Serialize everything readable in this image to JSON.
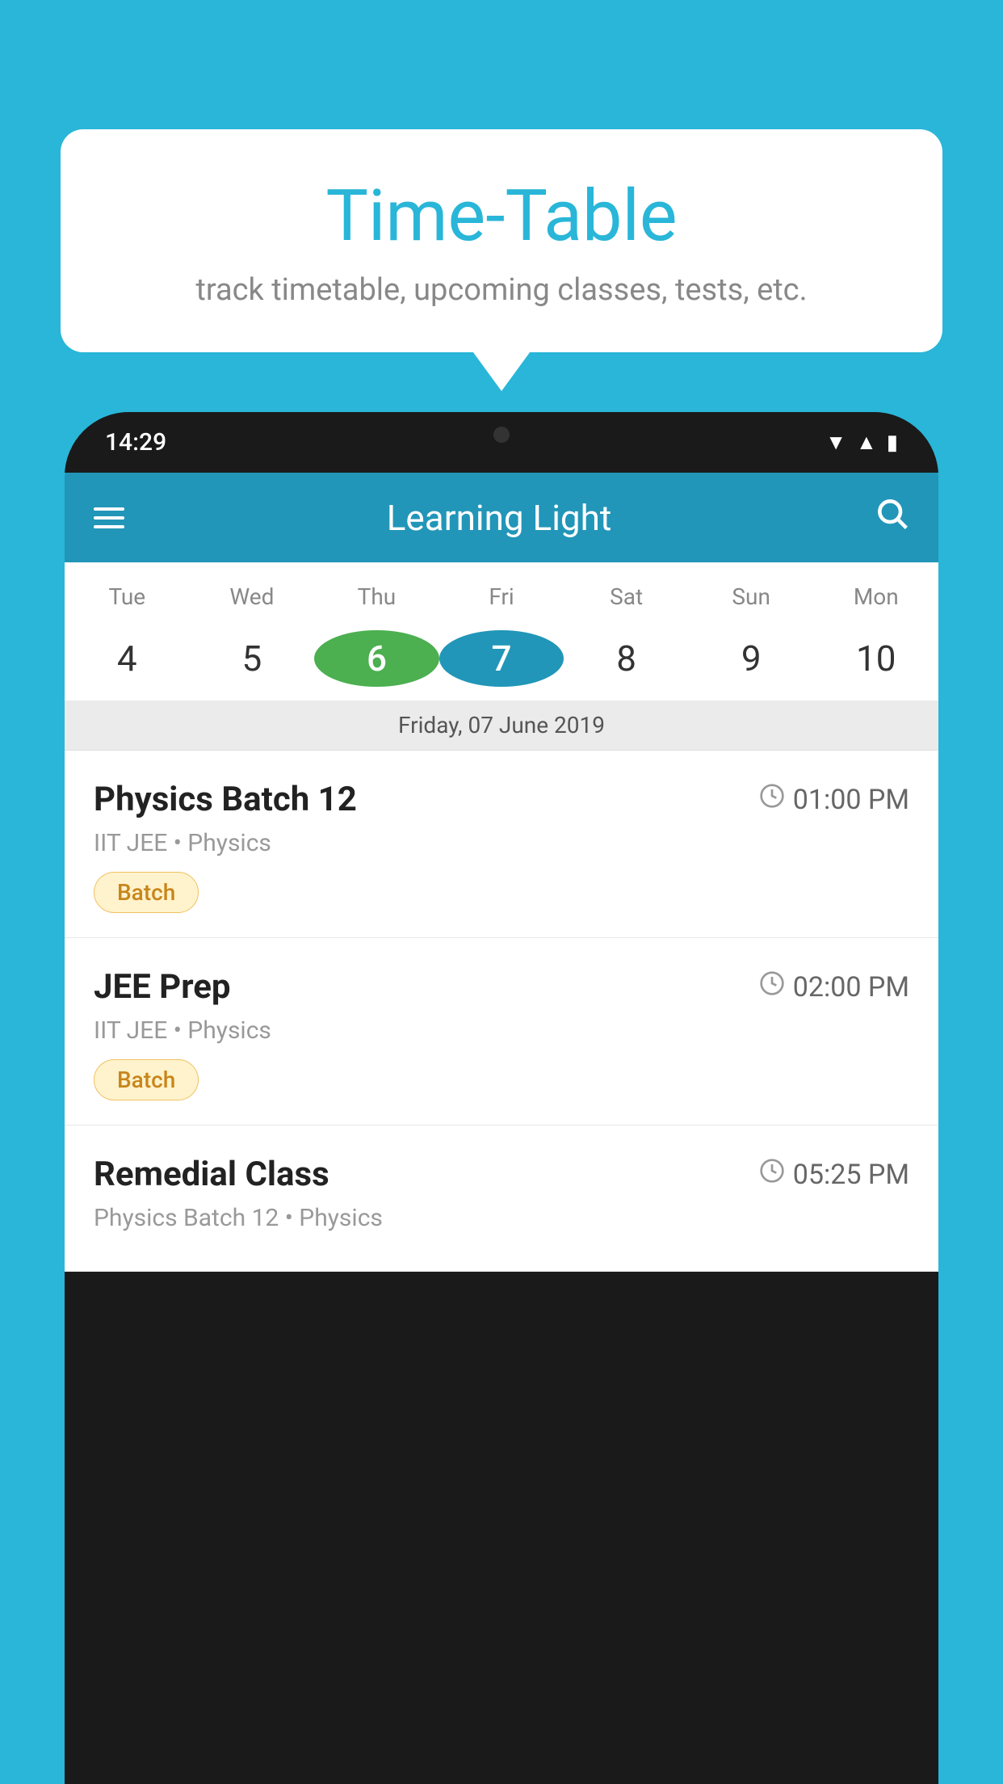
{
  "background_color": "#29b6d8",
  "bubble": {
    "title": "Time-Table",
    "subtitle": "track timetable, upcoming classes, tests, etc."
  },
  "phone": {
    "time": "14:29",
    "app_bar": {
      "menu_icon": "☰",
      "title": "Learning Light",
      "search_icon": "🔍"
    },
    "calendar": {
      "days": [
        "Tue",
        "Wed",
        "Thu",
        "Fri",
        "Sat",
        "Sun",
        "Mon"
      ],
      "dates": [
        "4",
        "5",
        "6",
        "7",
        "8",
        "9",
        "10"
      ],
      "today_index": 2,
      "selected_index": 3,
      "selected_label": "Friday, 07 June 2019"
    },
    "classes": [
      {
        "name": "Physics Batch 12",
        "time": "01:00 PM",
        "meta": "IIT JEE • Physics",
        "tag": "Batch"
      },
      {
        "name": "JEE Prep",
        "time": "02:00 PM",
        "meta": "IIT JEE • Physics",
        "tag": "Batch"
      },
      {
        "name": "Remedial Class",
        "time": "05:25 PM",
        "meta": "Physics Batch 12 • Physics",
        "tag": ""
      }
    ]
  }
}
